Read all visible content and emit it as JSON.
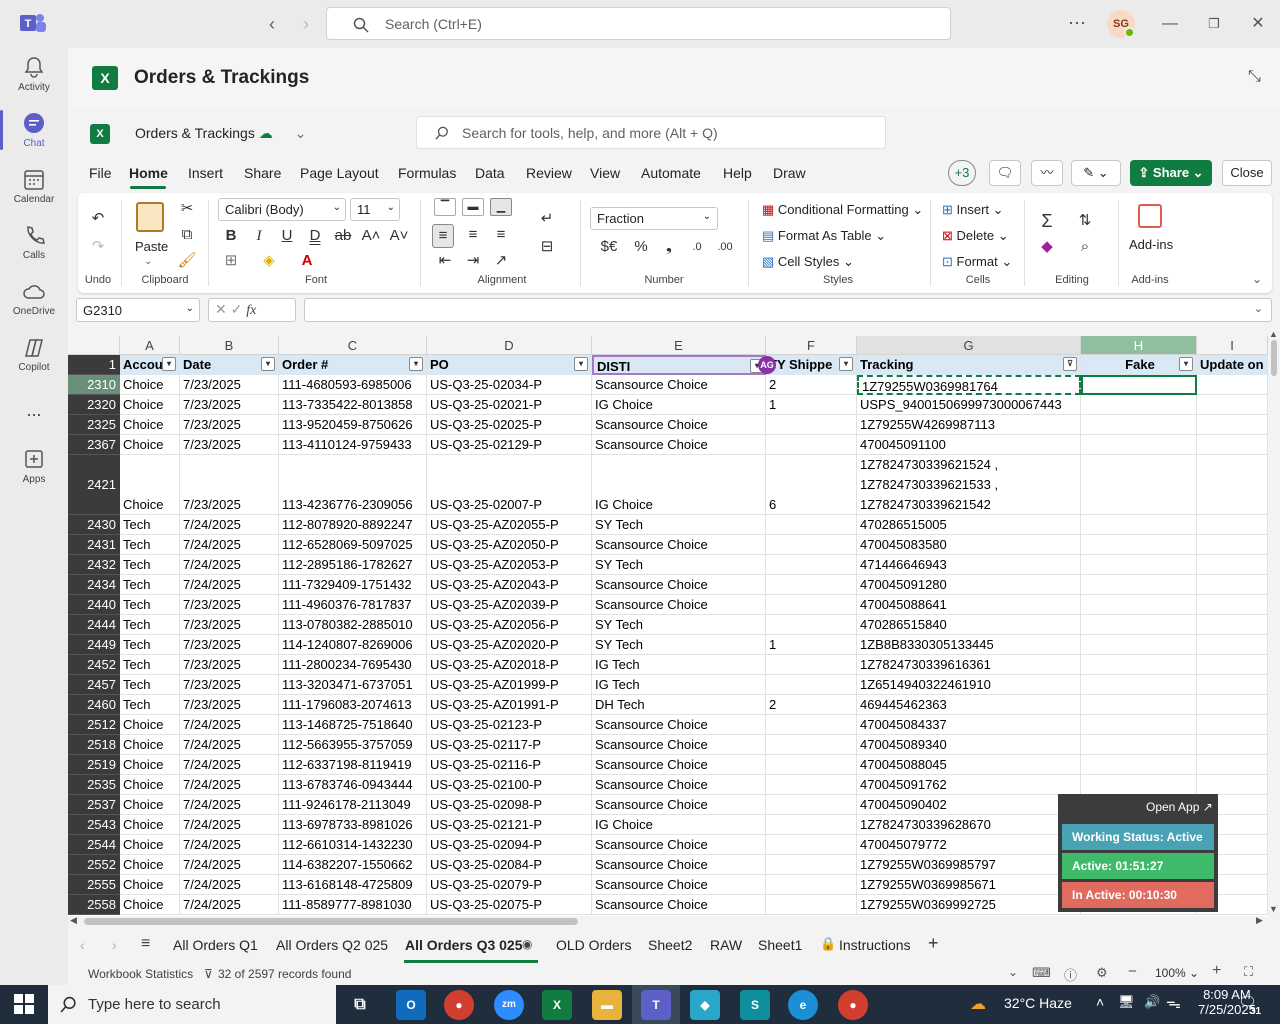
{
  "teams": {
    "search_placeholder": "Search (Ctrl+E)",
    "avatar_initials": "SG",
    "rail": [
      {
        "label": "Activity",
        "icon": "bell-icon"
      },
      {
        "label": "Chat",
        "icon": "chat-icon"
      },
      {
        "label": "Calendar",
        "icon": "calendar-icon"
      },
      {
        "label": "Calls",
        "icon": "phone-icon"
      },
      {
        "label": "OneDrive",
        "icon": "cloud-icon"
      },
      {
        "label": "Copilot",
        "icon": "copilot-icon"
      },
      {
        "label": "...",
        "icon": "more-icon"
      },
      {
        "label": "Apps",
        "icon": "apps-icon"
      }
    ],
    "app_title": "Orders & Trackings"
  },
  "excel": {
    "file_name": "Orders & Trackings",
    "search_placeholder": "Search for tools, help, and more (Alt + Q)",
    "menu": [
      "File",
      "Home",
      "Insert",
      "Share",
      "Page Layout",
      "Formulas",
      "Data",
      "Review",
      "View",
      "Automate",
      "Help",
      "Draw"
    ],
    "active_menu": "Home",
    "collaborators": "+3",
    "share_label": "Share",
    "close_label": "Close",
    "ribbon": {
      "undo_label": "Undo",
      "paste_label": "Paste",
      "clipboard_label": "Clipboard",
      "font_name": "Calibri (Body)",
      "font_size": "11",
      "font_label": "Font",
      "alignment_label": "Alignment",
      "number_format": "Fraction",
      "number_label": "Number",
      "cond_format": "Conditional Formatting",
      "format_table": "Format As Table",
      "cell_styles": "Cell Styles",
      "styles_label": "Styles",
      "insert": "Insert",
      "delete": "Delete",
      "format": "Format",
      "cells_label": "Cells",
      "editing_label": "Editing",
      "addins": "Add-ins",
      "addins_label": "Add-ins"
    },
    "name_box": "G2310",
    "fx": "fx",
    "columns": [
      "A",
      "B",
      "C",
      "D",
      "E",
      "F",
      "G",
      "H",
      "I"
    ],
    "headers": [
      "Accou",
      "Date",
      "Order #",
      "PO",
      "DISTI",
      "TY Shippe",
      "Tracking",
      "Fake",
      "Update on"
    ],
    "header_row_number": "1",
    "presence_badge": "AG",
    "rows": [
      {
        "n": "2310",
        "a": "Choice",
        "b": "7/23/2025",
        "c": "111-4680593-6985006",
        "d": "US-Q3-25-02034-P",
        "e": "Scansource Choice",
        "f": "2",
        "g": "1Z79255W0369981764"
      },
      {
        "n": "2320",
        "a": "Choice",
        "b": "7/23/2025",
        "c": "113-7335422-8013858",
        "d": "US-Q3-25-02021-P",
        "e": "IG Choice",
        "f": "1",
        "g": "USPS_9400150699973000067443"
      },
      {
        "n": "2325",
        "a": "Choice",
        "b": "7/23/2025",
        "c": "113-9520459-8750626",
        "d": "US-Q3-25-02025-P",
        "e": "Scansource Choice",
        "f": "",
        "g": "1Z79255W4269987113"
      },
      {
        "n": "2367",
        "a": "Choice",
        "b": "7/23/2025",
        "c": "113-4110124-9759433",
        "d": "US-Q3-25-02129-P",
        "e": "Scansource Choice",
        "f": "",
        "g": "470045091100"
      },
      {
        "n": "2421",
        "a": "Choice",
        "b": "7/23/2025",
        "c": "113-4236776-2309056",
        "d": "US-Q3-25-02007-P",
        "e": "IG Choice",
        "f": "6",
        "g": "1Z7824730339621524 ,",
        "g2": "1Z7824730339621533 ,",
        "g3": "1Z7824730339621542"
      },
      {
        "n": "2430",
        "a": "Tech",
        "b": "7/24/2025",
        "c": "112-8078920-8892247",
        "d": "US-Q3-25-AZ02055-P",
        "e": "SY Tech",
        "f": "",
        "g": "470286515005"
      },
      {
        "n": "2431",
        "a": "Tech",
        "b": "7/24/2025",
        "c": "112-6528069-5097025",
        "d": "US-Q3-25-AZ02050-P",
        "e": "Scansource Choice",
        "f": "",
        "g": "470045083580"
      },
      {
        "n": "2432",
        "a": "Tech",
        "b": "7/24/2025",
        "c": "112-2895186-1782627",
        "d": "US-Q3-25-AZ02053-P",
        "e": "SY Tech",
        "f": "",
        "g": "471446646943"
      },
      {
        "n": "2434",
        "a": "Tech",
        "b": "7/24/2025",
        "c": "111-7329409-1751432",
        "d": "US-Q3-25-AZ02043-P",
        "e": "Scansource Choice",
        "f": "",
        "g": "470045091280"
      },
      {
        "n": "2440",
        "a": "Tech",
        "b": "7/23/2025",
        "c": "111-4960376-7817837",
        "d": "US-Q3-25-AZ02039-P",
        "e": "Scansource Choice",
        "f": "",
        "g": "470045088641"
      },
      {
        "n": "2444",
        "a": "Tech",
        "b": "7/23/2025",
        "c": "113-0780382-2885010",
        "d": "US-Q3-25-AZ02056-P",
        "e": "SY Tech",
        "f": "",
        "g": "470286515840"
      },
      {
        "n": "2449",
        "a": "Tech",
        "b": "7/23/2025",
        "c": "114-1240807-8269006",
        "d": "US-Q3-25-AZ02020-P",
        "e": "SY Tech",
        "f": "1",
        "g": "1ZB8B8330305133445"
      },
      {
        "n": "2452",
        "a": "Tech",
        "b": "7/23/2025",
        "c": "111-2800234-7695430",
        "d": "US-Q3-25-AZ02018-P",
        "e": "IG Tech",
        "f": "",
        "g": "1Z7824730339616361"
      },
      {
        "n": "2457",
        "a": "Tech",
        "b": "7/23/2025",
        "c": "113-3203471-6737051",
        "d": "US-Q3-25-AZ01999-P",
        "e": "IG Tech",
        "f": "",
        "g": "1Z6514940322461910"
      },
      {
        "n": "2460",
        "a": "Tech",
        "b": "7/23/2025",
        "c": "111-1796083-2074613",
        "d": "US-Q3-25-AZ01991-P",
        "e": "DH Tech",
        "f": "2",
        "g": "469445462363"
      },
      {
        "n": "2512",
        "a": "Choice",
        "b": "7/24/2025",
        "c": "113-1468725-7518640",
        "d": "US-Q3-25-02123-P",
        "e": "Scansource Choice",
        "f": "",
        "g": "470045084337"
      },
      {
        "n": "2518",
        "a": "Choice",
        "b": "7/24/2025",
        "c": "112-5663955-3757059",
        "d": "US-Q3-25-02117-P",
        "e": "Scansource Choice",
        "f": "",
        "g": "470045089340"
      },
      {
        "n": "2519",
        "a": "Choice",
        "b": "7/24/2025",
        "c": "112-6337198-8119419",
        "d": "US-Q3-25-02116-P",
        "e": "Scansource Choice",
        "f": "",
        "g": "470045088045"
      },
      {
        "n": "2535",
        "a": "Choice",
        "b": "7/24/2025",
        "c": "113-6783746-0943444",
        "d": "US-Q3-25-02100-P",
        "e": "Scansource Choice",
        "f": "",
        "g": "470045091762"
      },
      {
        "n": "2537",
        "a": "Choice",
        "b": "7/24/2025",
        "c": "111-9246178-2113049",
        "d": "US-Q3-25-02098-P",
        "e": "Scansource Choice",
        "f": "",
        "g": "470045090402"
      },
      {
        "n": "2543",
        "a": "Choice",
        "b": "7/24/2025",
        "c": "113-6978733-8981026",
        "d": "US-Q3-25-02121-P",
        "e": "IG Choice",
        "f": "",
        "g": "1Z7824730339628670"
      },
      {
        "n": "2544",
        "a": "Choice",
        "b": "7/24/2025",
        "c": "112-6610314-1432230",
        "d": "US-Q3-25-02094-P",
        "e": "Scansource Choice",
        "f": "",
        "g": "470045079772"
      },
      {
        "n": "2552",
        "a": "Choice",
        "b": "7/24/2025",
        "c": "114-6382207-1550662",
        "d": "US-Q3-25-02084-P",
        "e": "Scansource Choice",
        "f": "",
        "g": "1Z79255W0369985797"
      },
      {
        "n": "2555",
        "a": "Choice",
        "b": "7/24/2025",
        "c": "113-6168148-4725809",
        "d": "US-Q3-25-02079-P",
        "e": "Scansource Choice",
        "f": "",
        "g": "1Z79255W0369985671"
      },
      {
        "n": "2558",
        "a": "Choice",
        "b": "7/24/2025",
        "c": "111-8589777-8981030",
        "d": "US-Q3-25-02075-P",
        "e": "Scansource Choice",
        "f": "",
        "g": "1Z79255W0369992725"
      }
    ],
    "sheets": [
      "All Orders Q1",
      "All Orders Q2 025",
      "All Orders Q3 025",
      "OLD Orders",
      "Sheet2",
      "RAW",
      "Sheet1",
      "Instructions"
    ],
    "active_sheet": "All Orders Q3 025",
    "status_left": "Workbook Statistics",
    "status_records": "32 of 2597 records found",
    "zoom": "100%"
  },
  "widget": {
    "open_app": "Open App ↗",
    "working_status": "Working Status: Active",
    "active_time": "Active: 01:51:27",
    "inactive_time": "In Active: 00:10:30",
    "colors": {
      "status": "#4aa3b5",
      "active": "#3fba6a",
      "inactive": "#e06b5e"
    }
  },
  "taskbar": {
    "search_placeholder": "Type here to search",
    "weather": "32°C  Haze",
    "time": "8:09 AM",
    "date": "7/25/2025",
    "notification_count": "31"
  }
}
